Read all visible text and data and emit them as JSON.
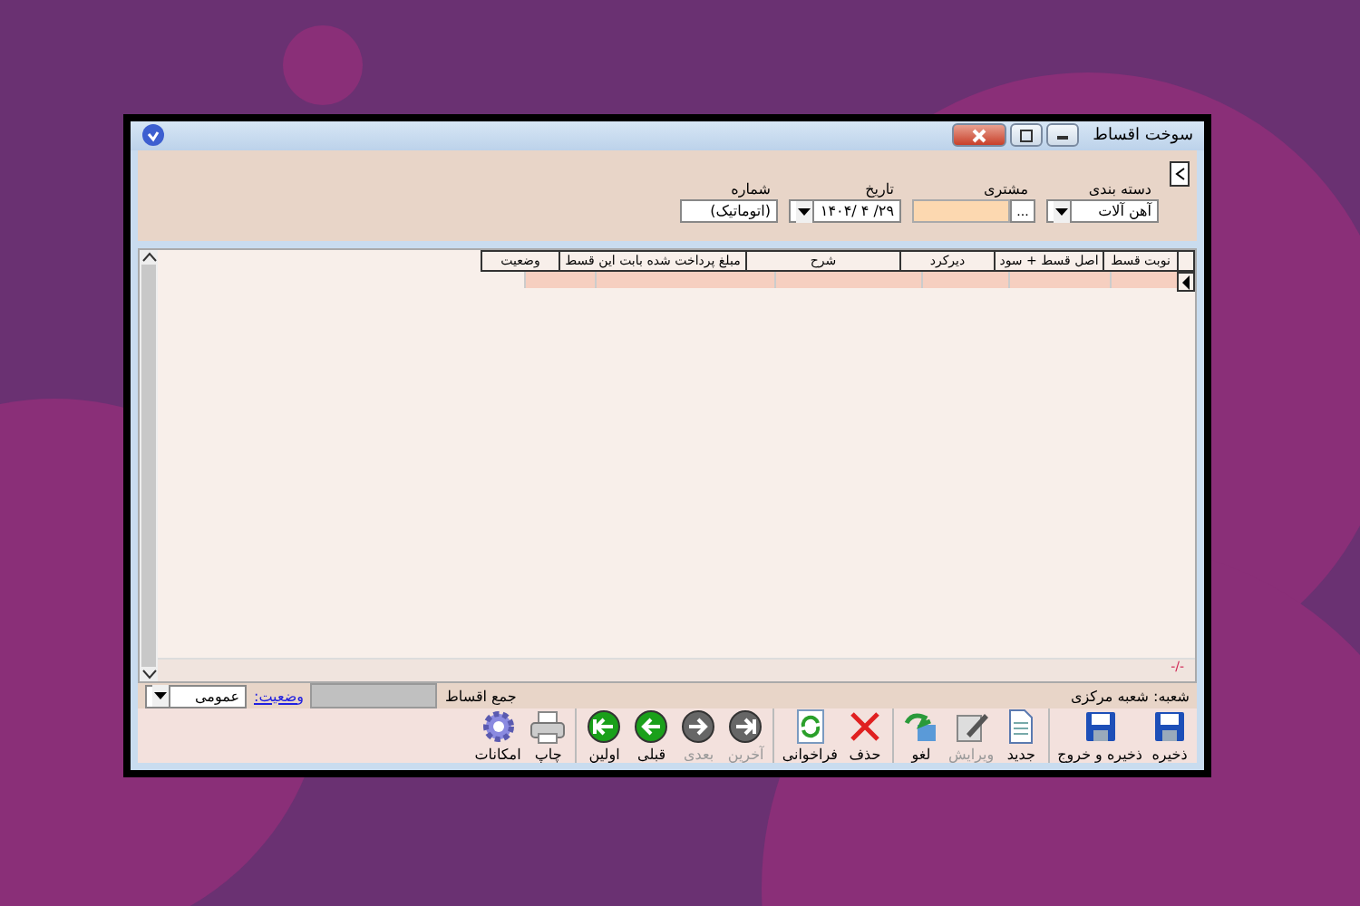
{
  "window": {
    "title": "سوخت اقساط"
  },
  "header": {
    "category": {
      "label": "دسته بندی",
      "value": "آهن آلات"
    },
    "customer": {
      "label": "مشتری",
      "button": "..."
    },
    "date": {
      "label": "تاریخ",
      "value": "۲۹/ ۴ /۱۴۰۴"
    },
    "number": {
      "label": "شماره",
      "value": "(اتوماتیک)"
    }
  },
  "table": {
    "columns": [
      "نوبت قسط",
      "اصل قسط + سود",
      "دیرکرد",
      "شرح",
      "مبلغ پرداخت شده بابت این قسط",
      "وضعیت"
    ],
    "total": "-/-"
  },
  "status_bar": {
    "branch": "شعبه: شعبه مرکزی",
    "sum_label": "جمع اقساط",
    "state_link": "وضعیت:",
    "state_value": "عمومی"
  },
  "toolbar": [
    {
      "kind": "save",
      "label": "ذخیره",
      "disabled": false
    },
    {
      "kind": "save",
      "label": "ذخیره و خروج",
      "disabled": false
    },
    {
      "kind": "new",
      "label": "جدید",
      "disabled": false
    },
    {
      "kind": "edit",
      "label": "ویرایش",
      "disabled": true
    },
    {
      "kind": "undo",
      "label": "لغو",
      "disabled": false
    },
    {
      "kind": "delete",
      "label": "حذف",
      "disabled": false
    },
    {
      "kind": "refresh",
      "label": "فراخوانی",
      "disabled": false
    },
    {
      "kind": "last",
      "label": "آخرین",
      "disabled": true
    },
    {
      "kind": "next",
      "label": "بعدی",
      "disabled": true
    },
    {
      "kind": "prev",
      "label": "قبلی",
      "disabled": false
    },
    {
      "kind": "first",
      "label": "اولین",
      "disabled": false
    },
    {
      "kind": "print",
      "label": "چاپ",
      "disabled": false
    },
    {
      "kind": "options",
      "label": "امکانات",
      "disabled": false
    }
  ]
}
